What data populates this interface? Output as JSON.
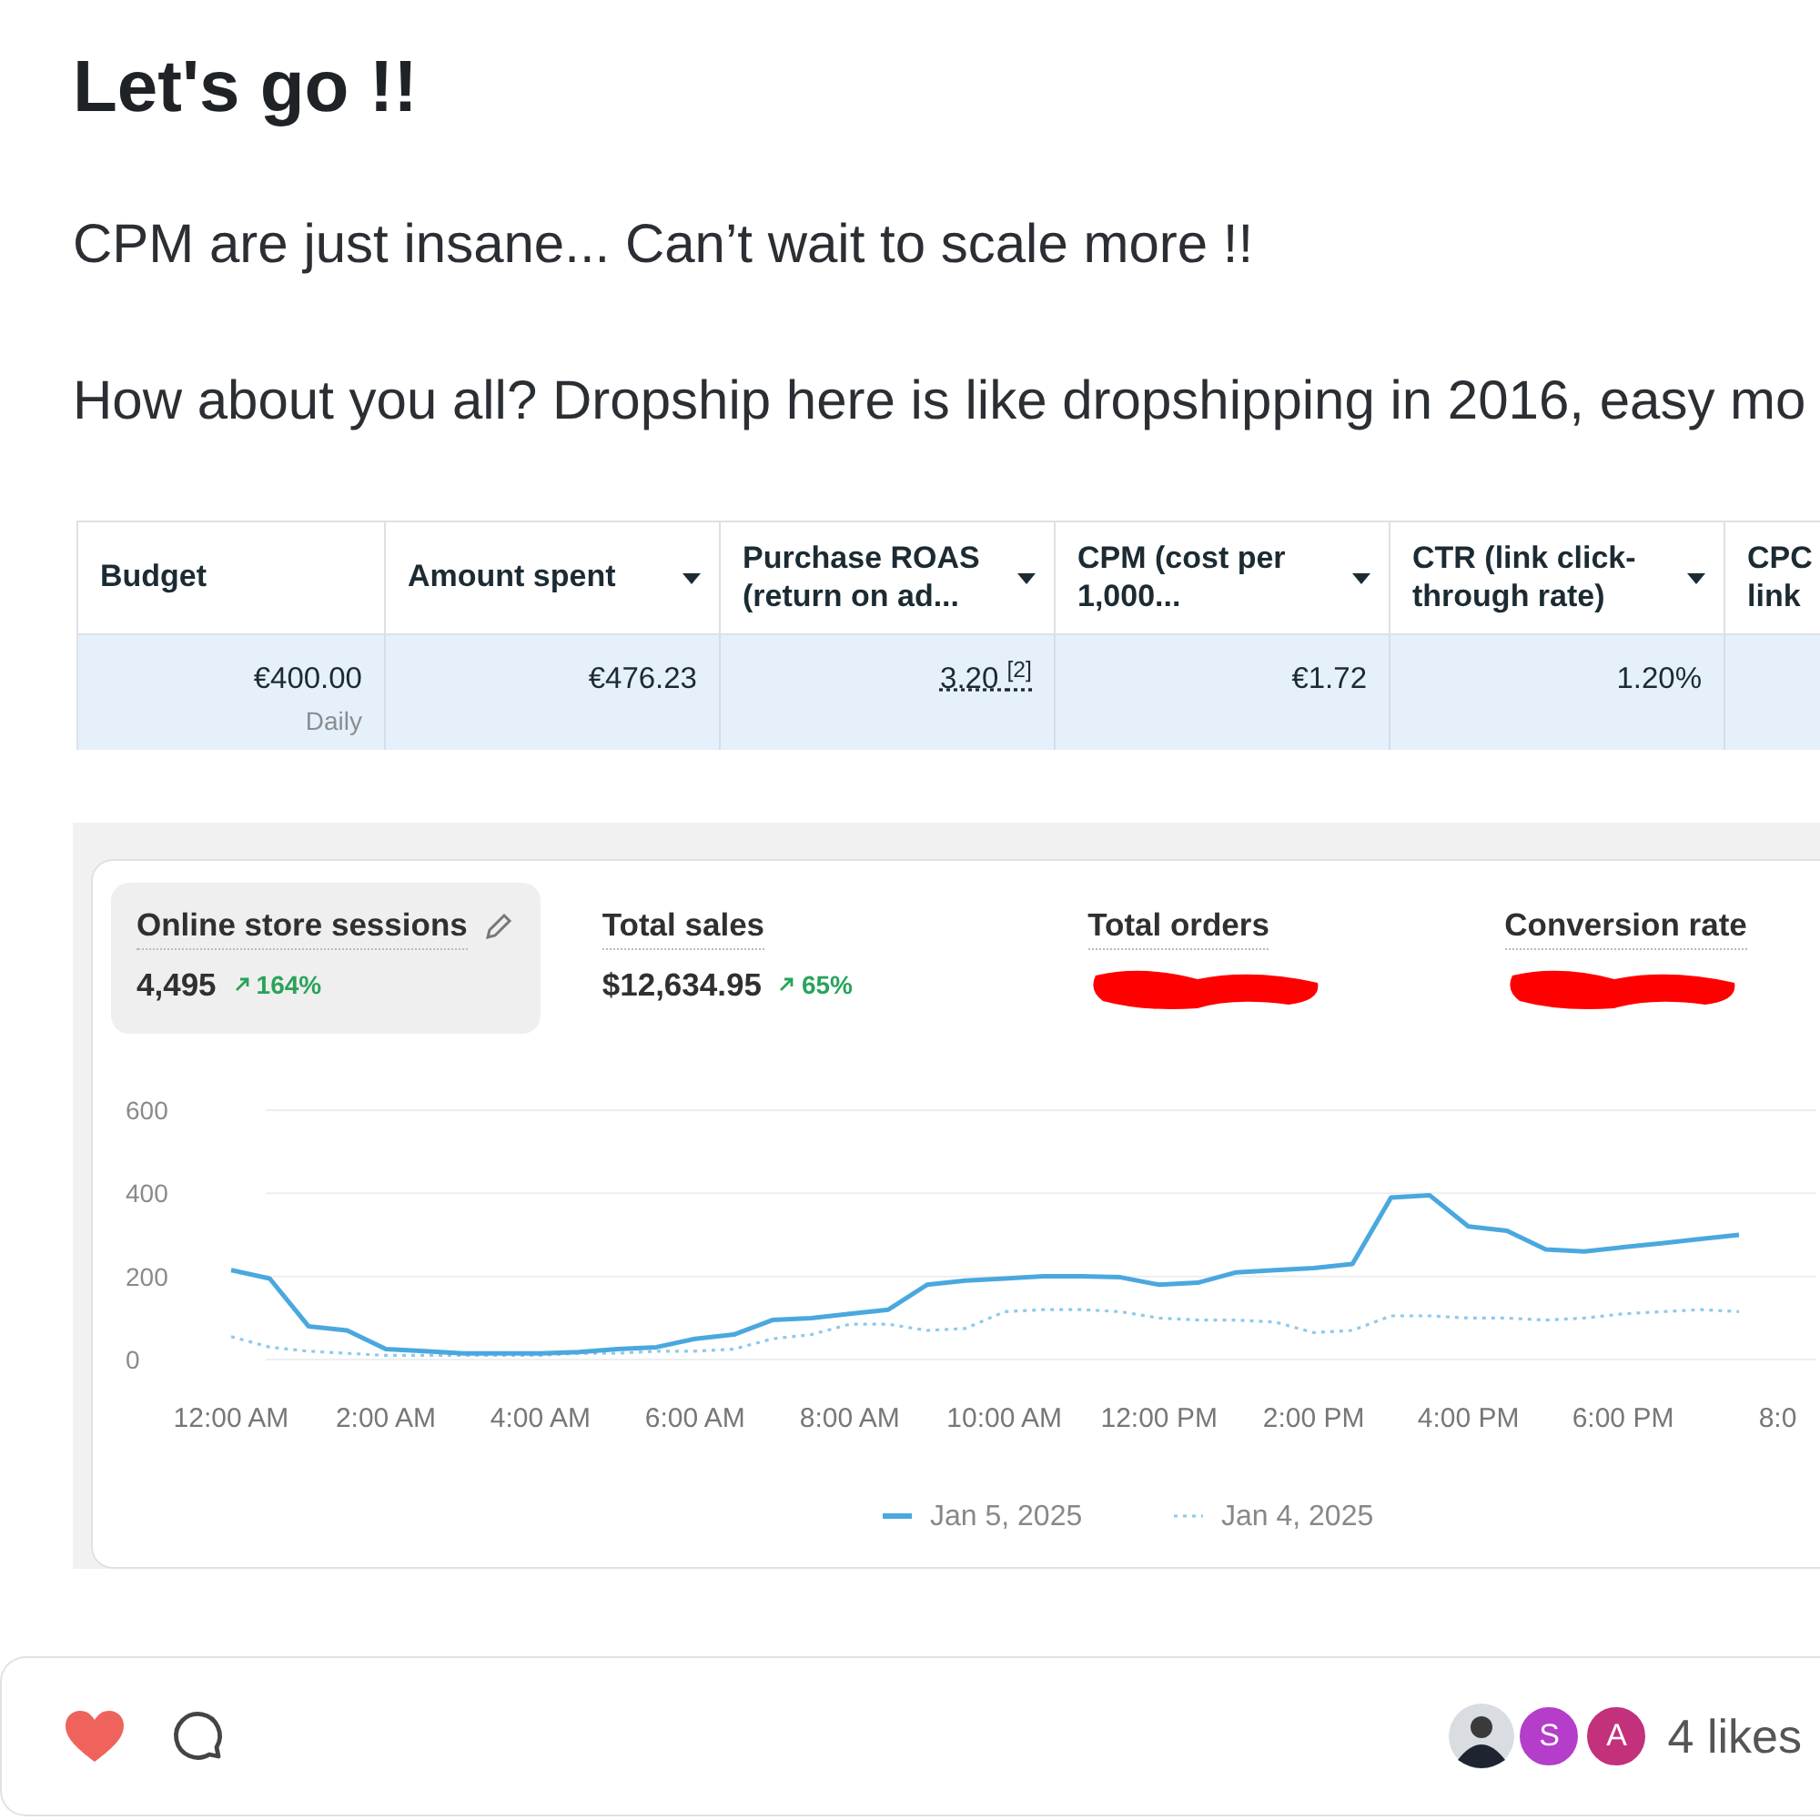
{
  "post": {
    "title": "Let's go !!",
    "paragraphs": [
      "CPM are just insane... Can’t wait to scale more !!",
      "How about you all? Dropship here is like dropshipping in 2016, easy mo"
    ]
  },
  "ads_table": {
    "columns": [
      {
        "label": "Budget",
        "dropdown": false
      },
      {
        "label": "Amount spent",
        "dropdown": true
      },
      {
        "label": "Purchase ROAS (return on ad...",
        "dropdown": true
      },
      {
        "label": "CPM (cost per 1,000...",
        "dropdown": true
      },
      {
        "label": "CTR (link click-through rate)",
        "dropdown": true
      },
      {
        "label": "CPC link"
      }
    ],
    "rows": [
      {
        "selected": true,
        "cells": [
          {
            "value": "€400.00",
            "note": "Daily"
          },
          {
            "value": "€476.23"
          },
          {
            "value": "3.20 $^{[2]}$"
          },
          {
            "value": "€1.72"
          },
          {
            "value": "1.20%"
          },
          {}
        ]
      }
    ]
  },
  "analytics": {
    "metrics": [
      {
        "label": "Online store sessions",
        "value": "4,495",
        "change": "164%",
        "selected": true,
        "redacted": false
      },
      {
        "label": "Total sales",
        "value": "$12,634.95",
        "change": "65%",
        "selected": false,
        "redacted": false
      },
      {
        "label": "Total orders",
        "selected": false,
        "redacted": true
      },
      {
        "label": "Conversion rate",
        "selected": false,
        "redacted": true
      }
    ],
    "chart_data": {
      "type": "line",
      "x": [
        0,
        0.5,
        1,
        1.5,
        2,
        2.5,
        3,
        3.5,
        4,
        4.5,
        5,
        5.5,
        6,
        6.5,
        7,
        7.5,
        8,
        8.5,
        9,
        9.5,
        10,
        10.5,
        11,
        11.5,
        12,
        12.5,
        13,
        13.5,
        14,
        14.5,
        15,
        15.5,
        16,
        16.5,
        17,
        17.5,
        18,
        18.5,
        19,
        19.5
      ],
      "xlim": [
        0,
        20.5
      ],
      "legend": true,
      "ylim": [
        0,
        600
      ],
      "yticks": [
        0,
        200,
        400,
        600
      ],
      "xticks": [
        {
          "value": 0,
          "label": "12:00 AM"
        },
        {
          "value": 2,
          "label": "2:00 AM"
        },
        {
          "value": 4,
          "label": "4:00 AM"
        },
        {
          "value": 6,
          "label": "6:00 AM"
        },
        {
          "value": 8,
          "label": "8:00 AM"
        },
        {
          "value": 10,
          "label": "10:00 AM"
        },
        {
          "value": 12,
          "label": "12:00 PM"
        },
        {
          "value": 14,
          "label": "2:00 PM"
        },
        {
          "value": 16,
          "label": "4:00 PM"
        },
        {
          "value": 18,
          "label": "6:00 PM"
        },
        {
          "value": 20,
          "label": "8:0"
        }
      ],
      "series": [
        {
          "name": "Jan 5, 2025",
          "color": "#4aa8de",
          "line_style": "solid",
          "values": [
            215,
            195,
            80,
            70,
            25,
            20,
            15,
            15,
            15,
            18,
            25,
            30,
            50,
            60,
            95,
            100,
            110,
            120,
            180,
            190,
            195,
            200,
            200,
            198,
            180,
            185,
            210,
            215,
            220,
            230,
            390,
            395,
            320,
            310,
            265,
            260,
            270,
            280,
            290,
            300
          ]
        },
        {
          "name": "Jan 4, 2025",
          "color": "#8ec9ec",
          "line_style": "dotted",
          "values": [
            55,
            30,
            20,
            15,
            10,
            10,
            10,
            10,
            10,
            15,
            15,
            20,
            20,
            25,
            50,
            60,
            85,
            85,
            70,
            75,
            115,
            120,
            120,
            115,
            100,
            95,
            95,
            90,
            65,
            70,
            105,
            105,
            100,
            100,
            95,
            100,
            110,
            115,
            120,
            115
          ]
        }
      ]
    }
  },
  "footer": {
    "liked": true,
    "likers": [
      {
        "kind": "photo"
      },
      {
        "kind": "initial",
        "letter": "S",
        "color": "#b43dc9"
      },
      {
        "kind": "initial",
        "letter": "A",
        "color": "#c3307c"
      }
    ],
    "likes": "4 likes"
  }
}
